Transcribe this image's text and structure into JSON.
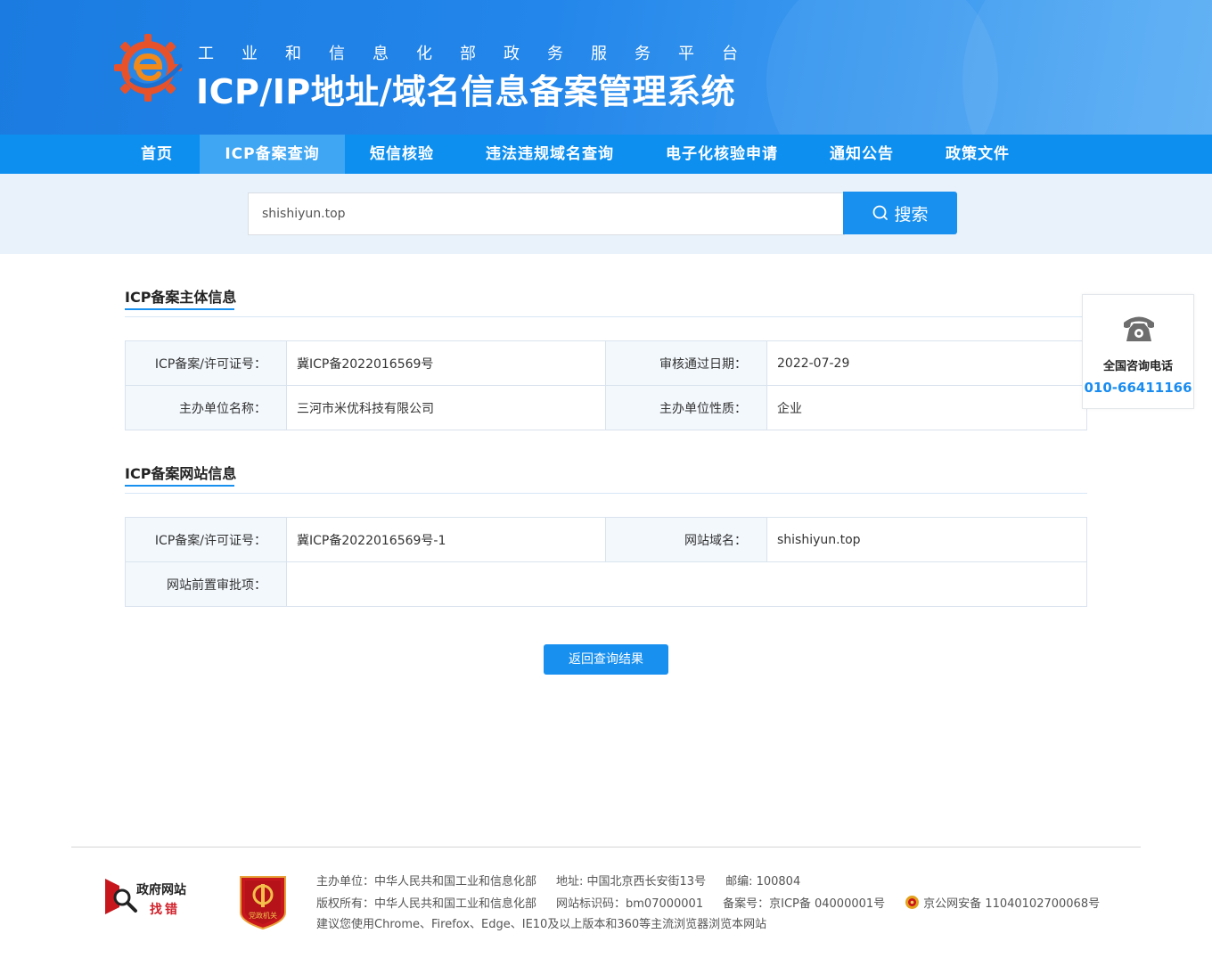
{
  "header": {
    "sub_title": "工业和信息化部政务服务平台",
    "main_title": "ICP/IP地址/域名信息备案管理系统"
  },
  "nav": {
    "items": [
      {
        "label": "首页"
      },
      {
        "label": "ICP备案查询",
        "active": true
      },
      {
        "label": "短信核验"
      },
      {
        "label": "违法违规域名查询"
      },
      {
        "label": "电子化核验申请"
      },
      {
        "label": "通知公告"
      },
      {
        "label": "政策文件"
      }
    ]
  },
  "search": {
    "value": "shishiyun.top",
    "button_label": "搜索"
  },
  "subject_info": {
    "title": "ICP备案主体信息",
    "license_label": "ICP备案/许可证号：",
    "license_value": "冀ICP备2022016569号",
    "approve_date_label": "审核通过日期：",
    "approve_date_value": "2022-07-29",
    "org_name_label": "主办单位名称：",
    "org_name_value": "三河市米优科技有限公司",
    "org_type_label": "主办单位性质：",
    "org_type_value": "企业"
  },
  "website_info": {
    "title": "ICP备案网站信息",
    "license_label": "ICP备案/许可证号：",
    "license_value": "冀ICP备2022016569号-1",
    "domain_label": "网站域名：",
    "domain_value": "shishiyun.top",
    "pre_approval_label": "网站前置审批项：",
    "pre_approval_value": ""
  },
  "back_button": "返回查询结果",
  "hotline": {
    "label": "全国咨询电话",
    "number": "010-66411166",
    "icon": "telephone-icon"
  },
  "footer": {
    "gov_badge_line1": "政府网站",
    "gov_badge_line2": "找错",
    "party_badge_text": "党政机关",
    "host": "主办单位：中华人民共和国工业和信息化部",
    "address": "地址: 中国北京西长安街13号",
    "postcode": "邮编: 100804",
    "copyright": "版权所有：中华人民共和国工业和信息化部",
    "site_id": "网站标识码：bm07000001",
    "icp_record": "备案号：京ICP备 04000001号",
    "police_record": "京公网安备 11040102700068号",
    "browser_tip": "建议您使用Chrome、Firefox、Edge、IE10及以上版本和360等主流浏览器浏览本网站"
  },
  "colors": {
    "primary": "#1890f0",
    "nav_bg": "#0d8ff0",
    "nav_active": "#3fa6f4",
    "hotline_number": "#1a8cf0"
  }
}
